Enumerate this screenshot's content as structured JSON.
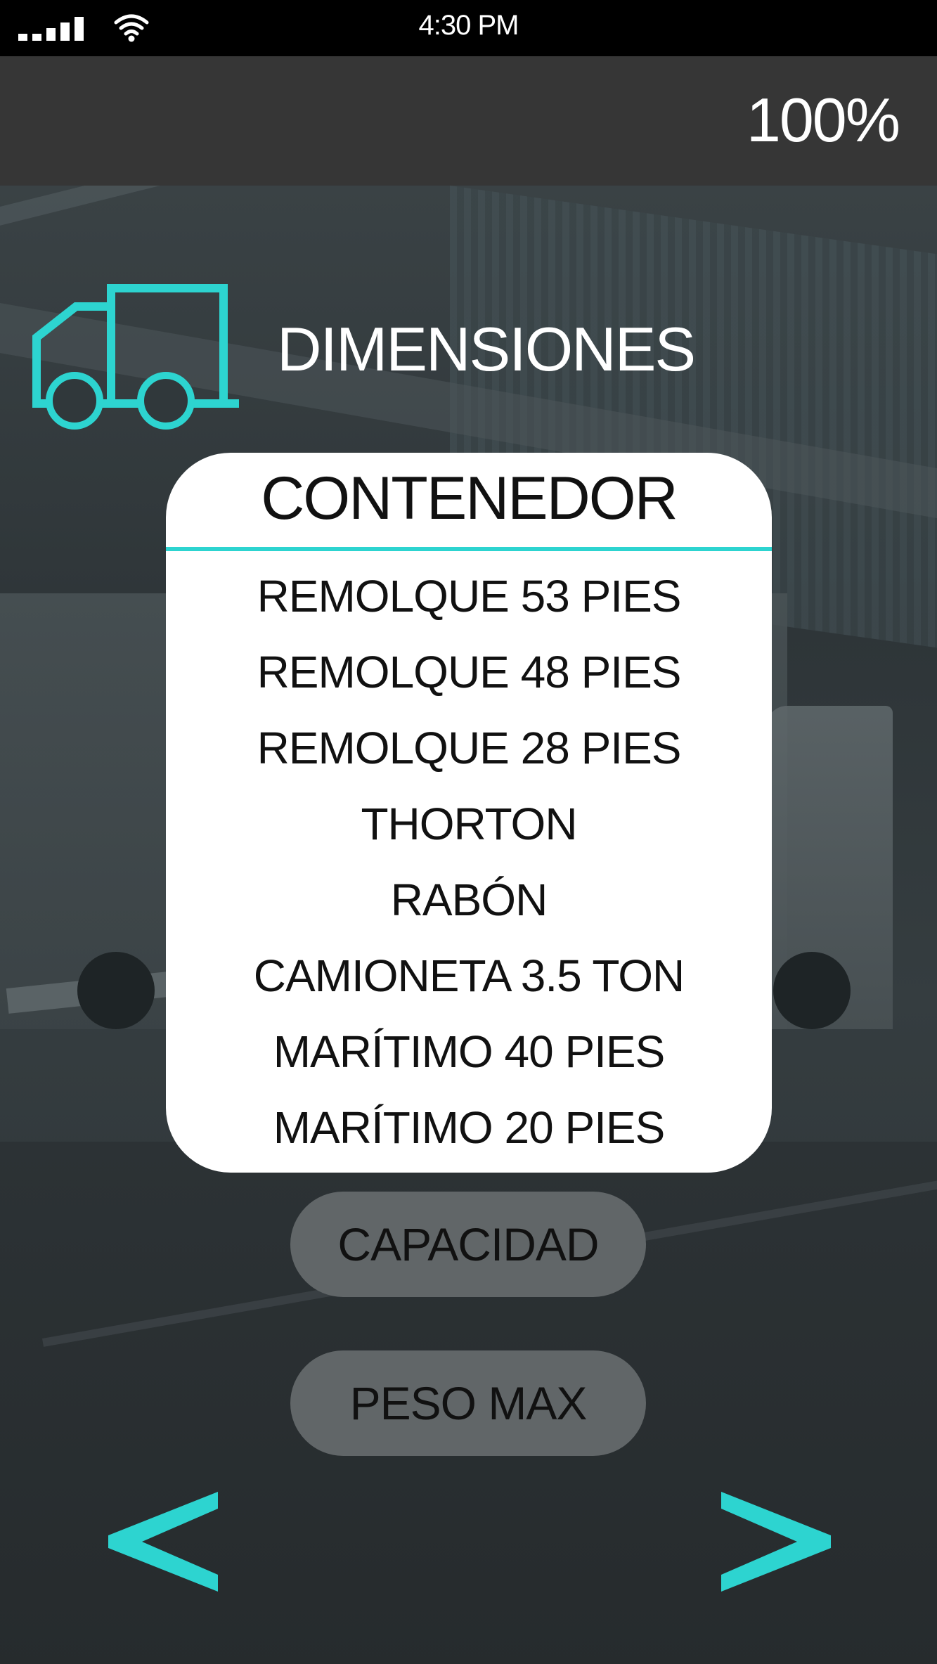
{
  "status_bar": {
    "time": "4:30 PM",
    "signal_icon": "signal-bars-icon",
    "wifi_icon": "wifi-icon"
  },
  "header": {
    "battery": "100%"
  },
  "section": {
    "icon": "truck-icon",
    "title": "DIMENSIONES"
  },
  "dropdown": {
    "selected": "CONTENEDOR",
    "options": [
      "REMOLQUE 53 PIES",
      "REMOLQUE 48 PIES",
      "REMOLQUE 28 PIES",
      "THORTON",
      "RABÓN",
      "CAMIONETA 3.5 TON",
      "MARÍTIMO 40 PIES",
      "MARÍTIMO 20 PIES"
    ]
  },
  "buttons": {
    "capacidad": "CAPACIDAD",
    "peso_max": "PESO MAX"
  },
  "navigation": {
    "prev_icon": "chevron-left-icon",
    "next_icon": "chevron-right-icon"
  },
  "colors": {
    "accent": "#2dd4d0",
    "header_bg": "#363636",
    "pill_bg": "#616668",
    "card_bg": "#ffffff"
  }
}
